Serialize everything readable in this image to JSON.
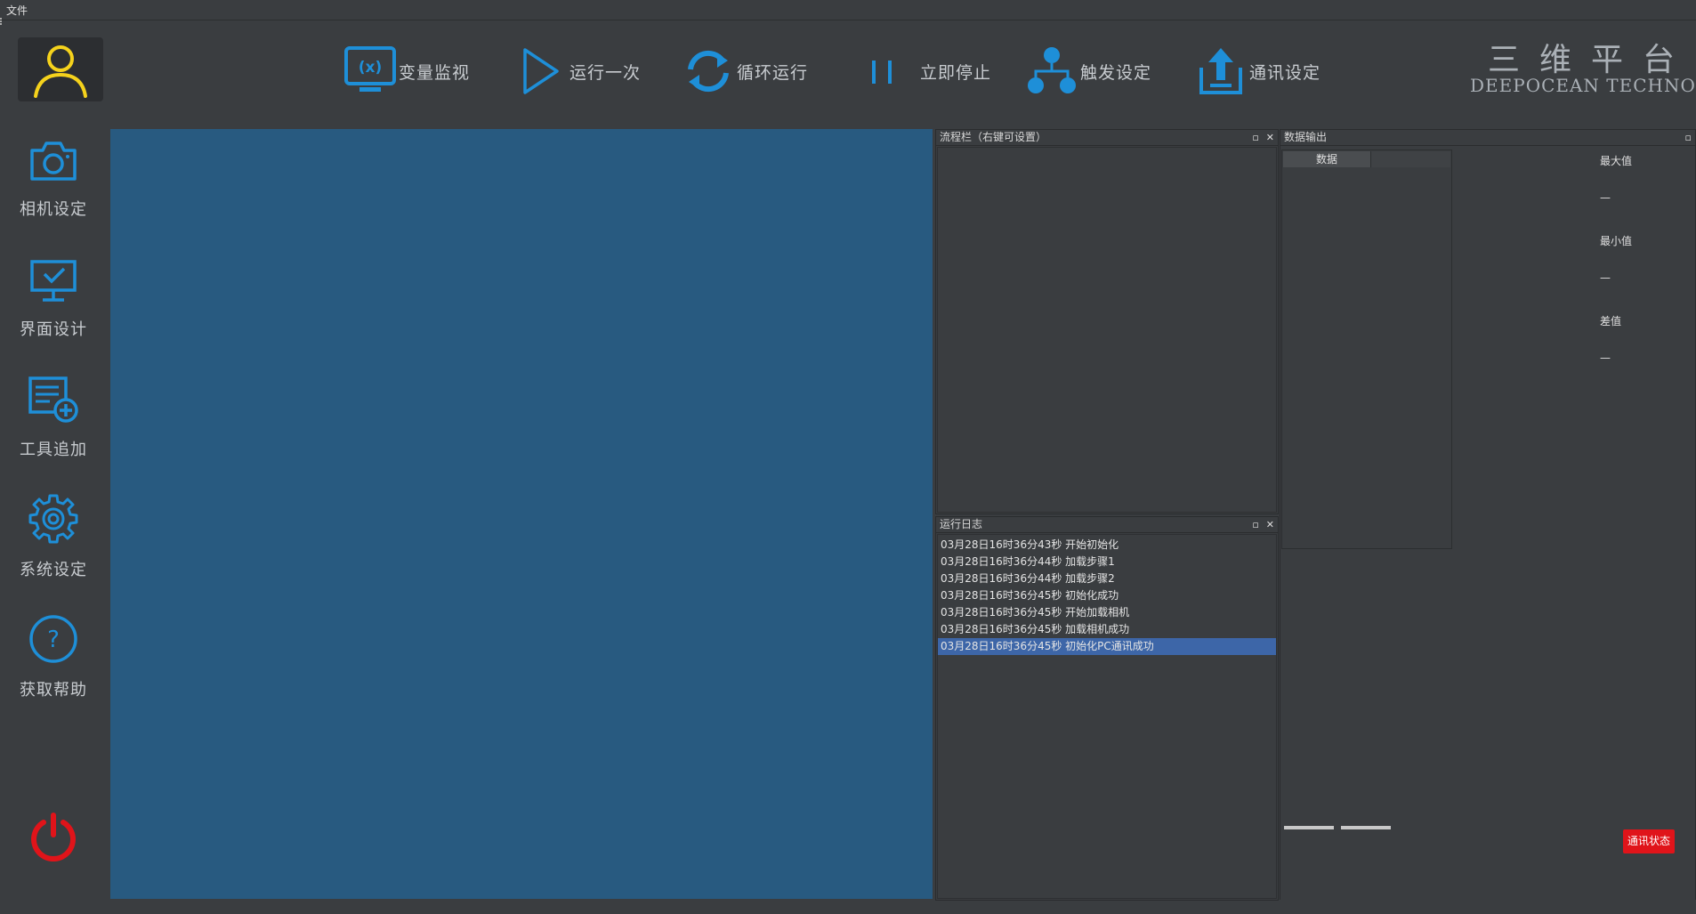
{
  "menubar": {
    "file_label": "文件"
  },
  "toolbar": {
    "buttons": [
      {
        "label": "变量监视",
        "icon": "variable-monitor-icon"
      },
      {
        "label": "运行一次",
        "icon": "play-icon"
      },
      {
        "label": "循环运行",
        "icon": "loop-icon"
      },
      {
        "label": "立即停止",
        "icon": "pause-icon"
      },
      {
        "label": "触发设定",
        "icon": "hierarchy-icon"
      },
      {
        "label": "通讯设定",
        "icon": "upload-icon"
      }
    ],
    "accent_color": "#1e8fd8"
  },
  "brand": {
    "cn": "三维平台",
    "en": "DEEPOCEAN TECHNOLOGY"
  },
  "sidebar": {
    "items": [
      {
        "label": "相机设定",
        "icon": "camera-icon"
      },
      {
        "label": "界面设计",
        "icon": "monitor-check-icon"
      },
      {
        "label": "工具追加",
        "icon": "list-add-icon"
      },
      {
        "label": "系统设定",
        "icon": "gear-icon"
      },
      {
        "label": "获取帮助",
        "icon": "help-icon"
      }
    ],
    "power_icon_color": "#e0141a"
  },
  "process_panel": {
    "title": "流程栏（右键可设置）"
  },
  "log_panel": {
    "title": "运行日志",
    "lines": [
      "03月28日16时36分43秒 开始初始化",
      "03月28日16时36分44秒 加载步骤1",
      "03月28日16时36分44秒 加载步骤2",
      "03月28日16时36分45秒 初始化成功",
      "03月28日16时36分45秒 开始加载相机",
      "03月28日16时36分45秒 加载相机成功",
      "03月28日16时36分45秒 初始化PC通讯成功"
    ],
    "selected_index": 6
  },
  "data_panel": {
    "title": "数据输出",
    "column_header": "数据",
    "stats": [
      {
        "label": "最大值",
        "value": "—"
      },
      {
        "label": "最小值",
        "value": "—"
      },
      {
        "label": "差值",
        "value": "—"
      }
    ]
  },
  "status_button": {
    "label": "通讯状态",
    "color": "#e0141a"
  }
}
